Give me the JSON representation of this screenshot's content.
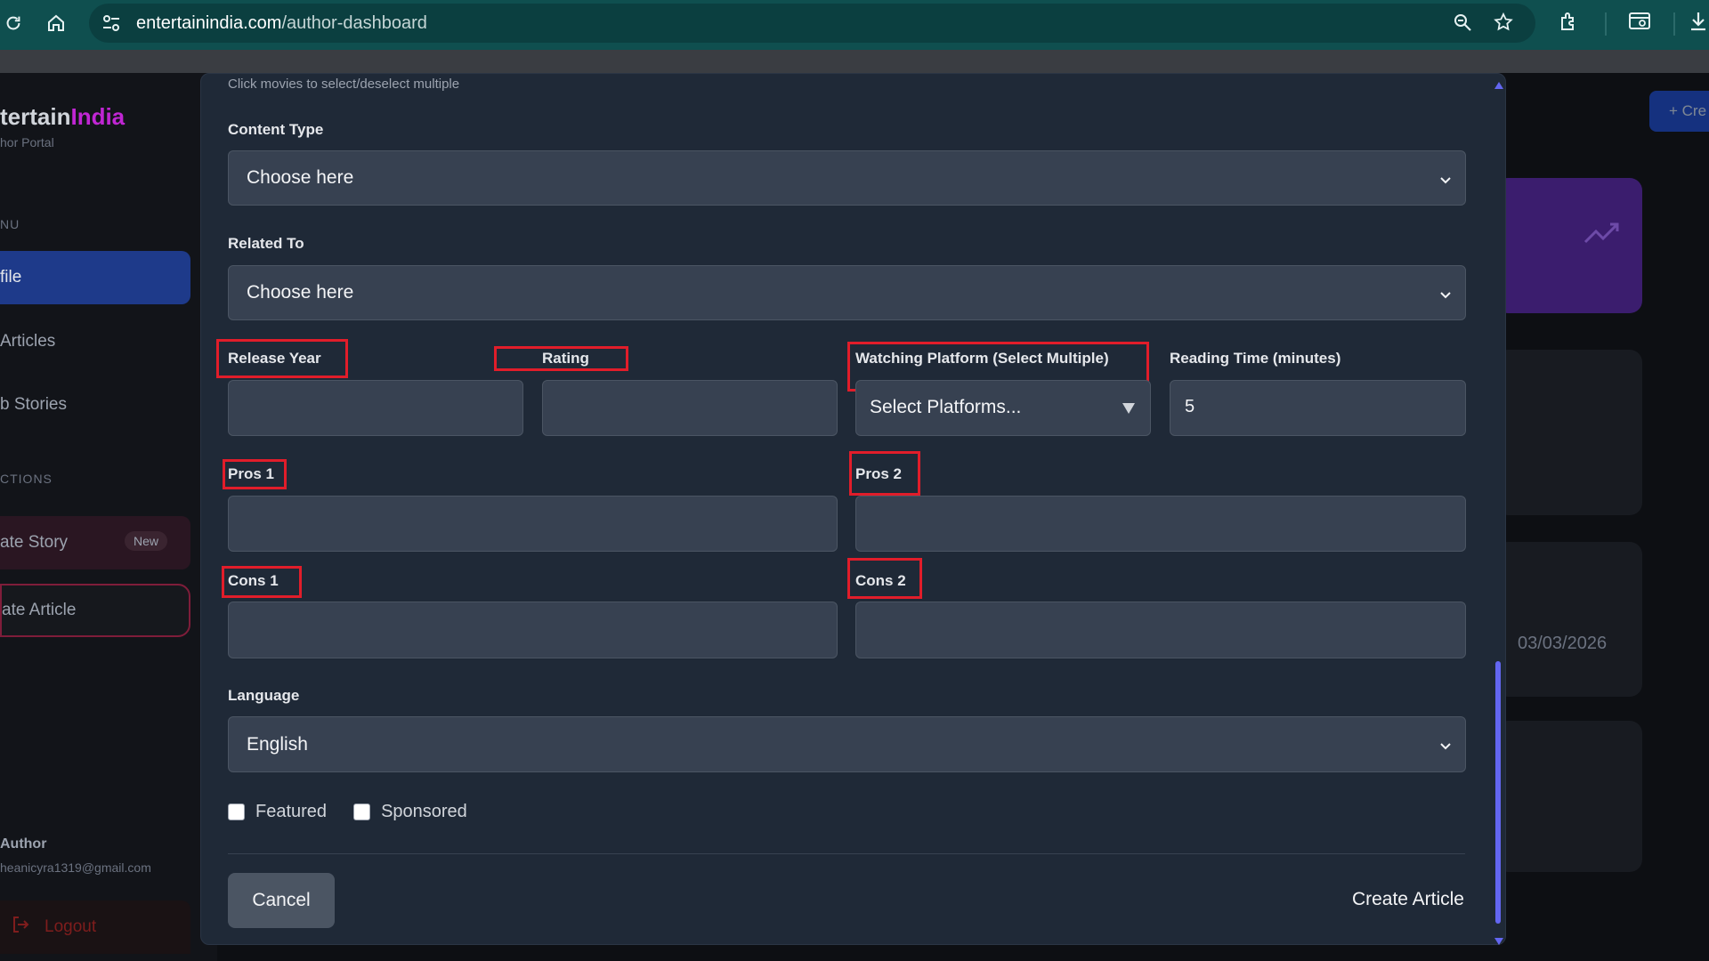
{
  "browser": {
    "url_domain": "entertainindia.com",
    "url_path": "/author-dashboard"
  },
  "sidebar": {
    "brand_part1": "tertain",
    "brand_part2": "India",
    "brand_sub": "hor Portal",
    "menu_heading": "NU",
    "items": [
      {
        "label": "file"
      },
      {
        "label": "Articles"
      },
      {
        "label": "b Stories"
      }
    ],
    "actions_heading": "CTIONS",
    "create_story": "ate Story",
    "new_badge": "New",
    "create_article": "ate Article",
    "author_title": "Author",
    "author_email": "heanicyra1319@gmail.com",
    "logout": "Logout"
  },
  "background": {
    "create_button": "+ Cre",
    "date": "03/03/2026"
  },
  "modal": {
    "hint": "Click movies to select/deselect multiple",
    "content_type": {
      "label": "Content Type",
      "value": "Choose here"
    },
    "related_to": {
      "label": "Related To",
      "value": "Choose here"
    },
    "release_year": {
      "label": "Release Year",
      "value": ""
    },
    "rating": {
      "label": "Rating",
      "value": ""
    },
    "watching_platform": {
      "label": "Watching Platform (Select Multiple)",
      "placeholder": "Select Platforms..."
    },
    "reading_time": {
      "label": "Reading Time (minutes)",
      "value": "5"
    },
    "pros1": {
      "label": "Pros 1",
      "value": ""
    },
    "pros2": {
      "label": "Pros 2",
      "value": ""
    },
    "cons1": {
      "label": "Cons 1",
      "value": ""
    },
    "cons2": {
      "label": "Cons 2",
      "value": ""
    },
    "language": {
      "label": "Language",
      "value": "English"
    },
    "featured": {
      "label": "Featured",
      "checked": false
    },
    "sponsored": {
      "label": "Sponsored",
      "checked": false
    },
    "cancel_label": "Cancel",
    "create_label": "Create Article"
  },
  "colors": {
    "highlight": "#e11d2a",
    "modal_bg": "#1f2937",
    "input_bg": "#374151",
    "scroll_thumb": "#6366f1",
    "chrome_bg": "#0f4f4f"
  },
  "icons": [
    "reload-icon",
    "home-icon",
    "site-settings-icon",
    "zoom-icon",
    "star-icon",
    "extensions-icon",
    "split-view-icon",
    "download-icon",
    "chevron-down-icon",
    "trending-up-icon",
    "logout-icon"
  ]
}
